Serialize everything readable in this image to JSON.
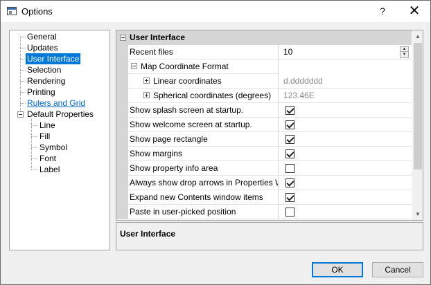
{
  "window": {
    "title": "Options"
  },
  "titlebar": {
    "help_label": "?",
    "close_label": "✕"
  },
  "tree": {
    "items": [
      {
        "label": "General"
      },
      {
        "label": "Updates"
      },
      {
        "label": "User Interface",
        "selected": true
      },
      {
        "label": "Selection"
      },
      {
        "label": "Rendering"
      },
      {
        "label": "Printing"
      },
      {
        "label": "Rulers and Grid",
        "link": true
      },
      {
        "label": "Default Properties",
        "expanded": true
      },
      {
        "label": "Line"
      },
      {
        "label": "Fill"
      },
      {
        "label": "Symbol"
      },
      {
        "label": "Font"
      },
      {
        "label": "Label"
      }
    ]
  },
  "grid": {
    "category": "User Interface",
    "rows": [
      {
        "name": "Recent files",
        "value": "10",
        "type": "spinner"
      },
      {
        "name": "Map Coordinate Format",
        "value": "",
        "type": "group"
      },
      {
        "name": "Linear coordinates",
        "value": "d.ddddddd",
        "type": "readonly"
      },
      {
        "name": "Spherical coordinates (degrees)",
        "value": "123.46E",
        "type": "readonly"
      },
      {
        "name": "Show splash screen at startup.",
        "checked": true
      },
      {
        "name": "Show welcome screen at startup.",
        "checked": true
      },
      {
        "name": "Show page rectangle",
        "checked": true
      },
      {
        "name": "Show margins",
        "checked": true
      },
      {
        "name": "Show property info area",
        "checked": false
      },
      {
        "name": "Always show drop arrows in Properties Wi...",
        "checked": true
      },
      {
        "name": "Expand new Contents window items",
        "checked": true
      },
      {
        "name": "Paste in user-picked position",
        "checked": false
      }
    ]
  },
  "description": {
    "title": "User Interface"
  },
  "buttons": {
    "ok": "OK",
    "cancel": "Cancel"
  },
  "colors": {
    "accent": "#0078d7",
    "link": "#0066cc",
    "header_bg": "#d6d6d6"
  }
}
